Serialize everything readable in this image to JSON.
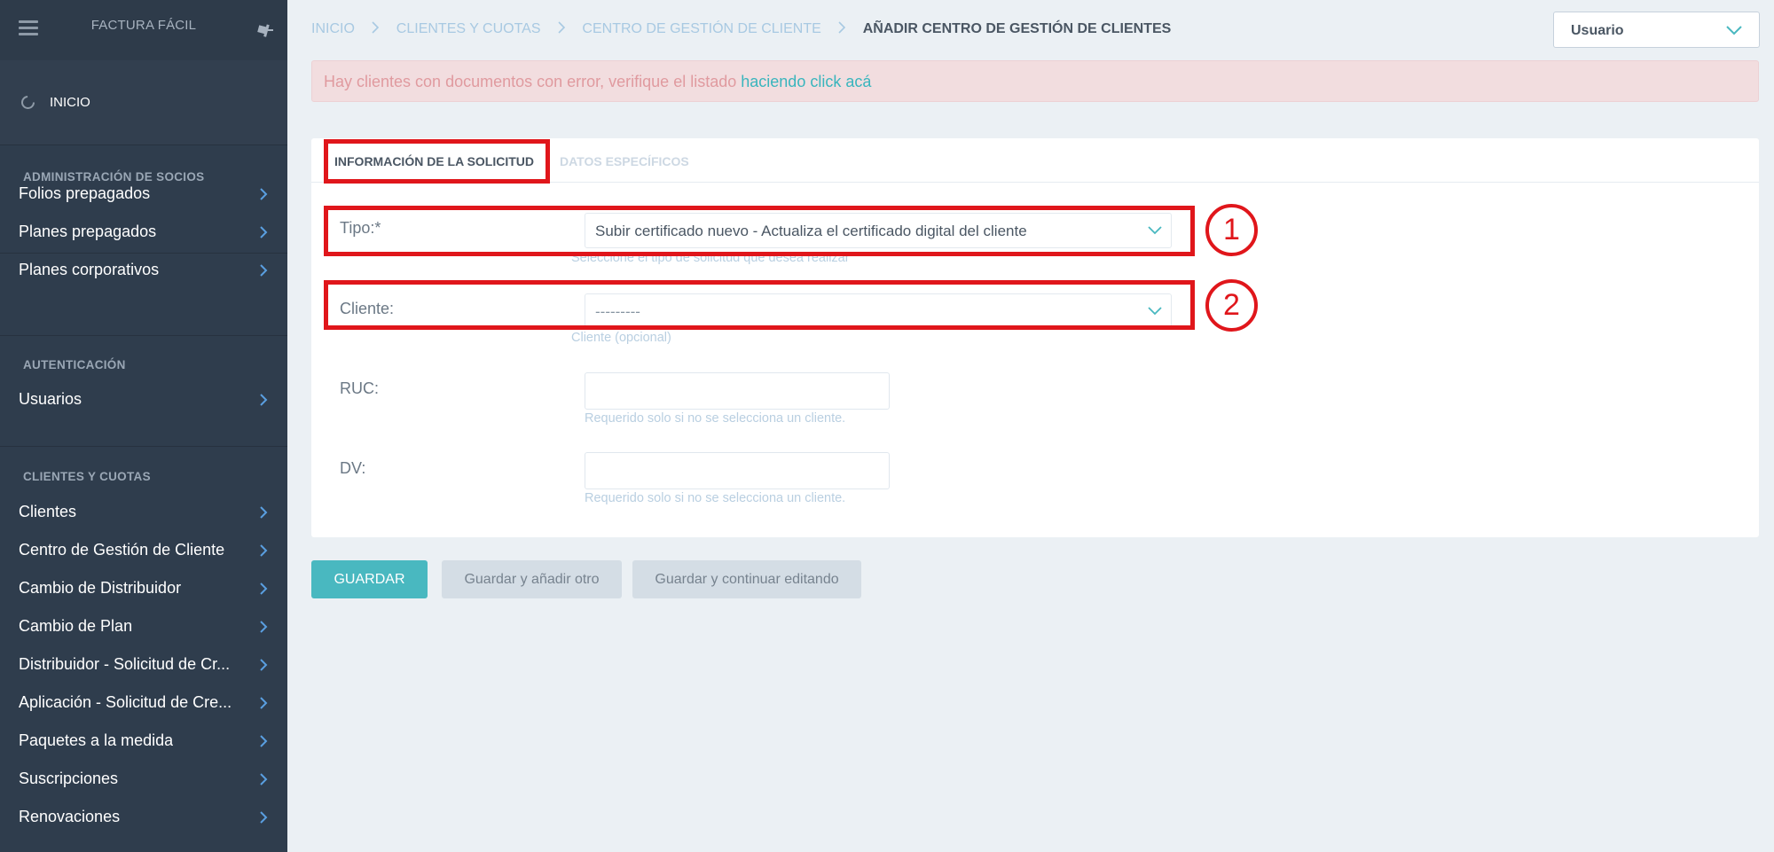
{
  "sidebar": {
    "brand": "FACTURA FÁCIL",
    "home_label": "INICIO",
    "sections": [
      {
        "title": "ADMINISTRACIÓN DE SOCIOS",
        "items": [
          "Folios prepagados",
          "Planes prepagados",
          "Planes corporativos"
        ]
      },
      {
        "title": "AUTENTICACIÓN",
        "items": [
          "Usuarios"
        ]
      },
      {
        "title": "CLIENTES Y CUOTAS",
        "items": [
          "Clientes",
          "Centro de Gestión de Cliente",
          "Cambio de Distribuidor",
          "Cambio de Plan",
          "Distribuidor - Solicitud de Cr...",
          "Aplicación - Solicitud de Cre...",
          "Paquetes a la medida",
          "Suscripciones",
          "Renovaciones"
        ]
      }
    ]
  },
  "breadcrumb": {
    "items": [
      "INICIO",
      "CLIENTES Y CUOTAS",
      "CENTRO DE GESTIÓN DE CLIENTE"
    ],
    "current": "AÑADIR CENTRO DE GESTIÓN DE CLIENTES"
  },
  "user_menu": {
    "value": "Usuario"
  },
  "alert": {
    "message": "Hay clientes con documentos con error, verifique el listado",
    "link_text": "haciendo click acá"
  },
  "tabs": {
    "info": "INFORMACIÓN DE LA SOLICITUD",
    "datos": "DATOS ESPECÍFICOS"
  },
  "form": {
    "tipo": {
      "label": "Tipo:*",
      "value": "Subir certificado nuevo - Actualiza el certificado digital del cliente",
      "help": "Seleccione el tipo de solicitud que desea realizar"
    },
    "cliente": {
      "label": "Cliente:",
      "value": "---------",
      "help": "Cliente (opcional)"
    },
    "ruc": {
      "label": "RUC:",
      "value": "",
      "help": "Requerido solo si no se selecciona un cliente."
    },
    "dv": {
      "label": "DV:",
      "value": "",
      "help": "Requerido solo si no se selecciona un cliente."
    }
  },
  "buttons": {
    "save": "GUARDAR",
    "save_add": "Guardar y añadir otro",
    "save_continue": "Guardar y continuar editando"
  },
  "annotations": {
    "marker_1": "1",
    "marker_2": "2"
  },
  "colors": {
    "sidebar_bg": "#2f3d4d",
    "accent": "#49b8c0",
    "alert_bg": "#f2dddf",
    "alert_text": "#e09a9f",
    "highlight": "#e0161b"
  }
}
